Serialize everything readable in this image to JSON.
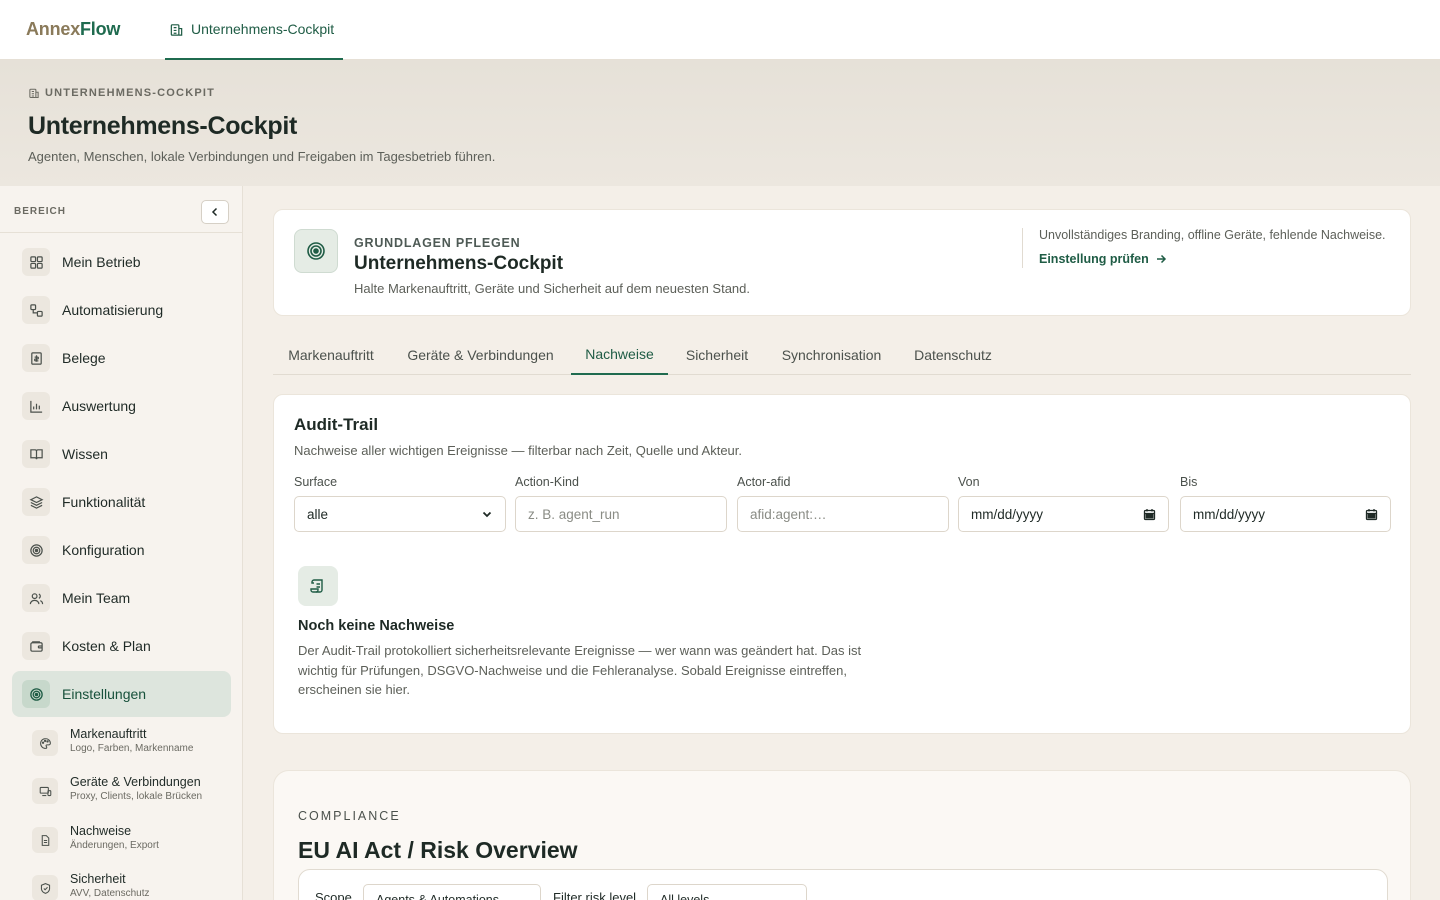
{
  "app": {
    "brand_part1": "Annex",
    "brand_part2": "Flow",
    "top_tab": "Unternehmens-Cockpit"
  },
  "hero": {
    "eyebrow": "UNTERNEHMENS-COCKPIT",
    "title": "Unternehmens-Cockpit",
    "subtitle": "Agenten, Menschen, lokale Verbindungen und Freigaben im Tagesbetrieb führen."
  },
  "sidebar": {
    "label": "BEREICH",
    "items": [
      {
        "label": "Mein Betrieb",
        "icon": "grid-icon"
      },
      {
        "label": "Automatisierung",
        "icon": "workflow-icon"
      },
      {
        "label": "Belege",
        "icon": "receipt-icon"
      },
      {
        "label": "Auswertung",
        "icon": "bar-chart-icon"
      },
      {
        "label": "Wissen",
        "icon": "book-icon"
      },
      {
        "label": "Funktionalität",
        "icon": "layers-icon"
      },
      {
        "label": "Konfiguration",
        "icon": "target-icon"
      },
      {
        "label": "Mein Team",
        "icon": "users-icon"
      },
      {
        "label": "Kosten & Plan",
        "icon": "wallet-icon"
      },
      {
        "label": "Einstellungen",
        "icon": "target-icon"
      }
    ],
    "subitems": [
      {
        "title": "Markenauftritt",
        "desc": "Logo, Farben, Markenname",
        "icon": "palette-icon"
      },
      {
        "title": "Geräte & Verbindungen",
        "desc": "Proxy, Clients, lokale Brücken",
        "icon": "devices-icon"
      },
      {
        "title": "Nachweise",
        "desc": "Änderungen, Export",
        "icon": "document-icon"
      },
      {
        "title": "Sicherheit",
        "desc": "AVV, Datenschutz",
        "icon": "shield-icon"
      }
    ]
  },
  "top_card": {
    "eyebrow": "GRUNDLAGEN PFLEGEN",
    "title": "Unternehmens-Cockpit",
    "subtitle": "Halte Markenauftritt, Geräte und Sicherheit auf dem neuesten Stand.",
    "note": "Unvollständiges Branding, offline Geräte, fehlende Nachweise.",
    "link": "Einstellung prüfen"
  },
  "tabs": [
    "Markenauftritt",
    "Geräte & Verbindungen",
    "Nachweise",
    "Sicherheit",
    "Synchronisation",
    "Datenschutz"
  ],
  "audit": {
    "title": "Audit-Trail",
    "subtitle": "Nachweise aller wichtigen Ereignisse — filterbar nach Zeit, Quelle und Akteur.",
    "filters": {
      "surface_label": "Surface",
      "surface_value": "alle",
      "action_label": "Action-Kind",
      "action_placeholder": "z. B. agent_run",
      "actor_label": "Actor-afid",
      "actor_placeholder": "afid:agent:…",
      "from_label": "Von",
      "from_value": "mm/dd/yyyy",
      "to_label": "Bis",
      "to_value": "mm/dd/yyyy"
    },
    "empty_title": "Noch keine Nachweise",
    "empty_text": "Der Audit-Trail protokolliert sicherheitsrelevante Ereignisse — wer wann was geändert hat. Das ist wichtig für Prüfungen, DSGVO-Nachweise und die Fehleranalyse. Sobald Ereignisse eintreffen, erscheinen sie hier."
  },
  "compliance": {
    "eyebrow": "COMPLIANCE",
    "title": "EU AI Act / Risk Overview",
    "scope_label": "Scope",
    "scope_value": "Agents & Automations",
    "risk_label": "Filter risk level",
    "risk_value": "All levels"
  },
  "colors": {
    "accent": "#1f6b4f",
    "brand_muted": "#8a7a5a",
    "page_bg": "#f4efe8"
  }
}
